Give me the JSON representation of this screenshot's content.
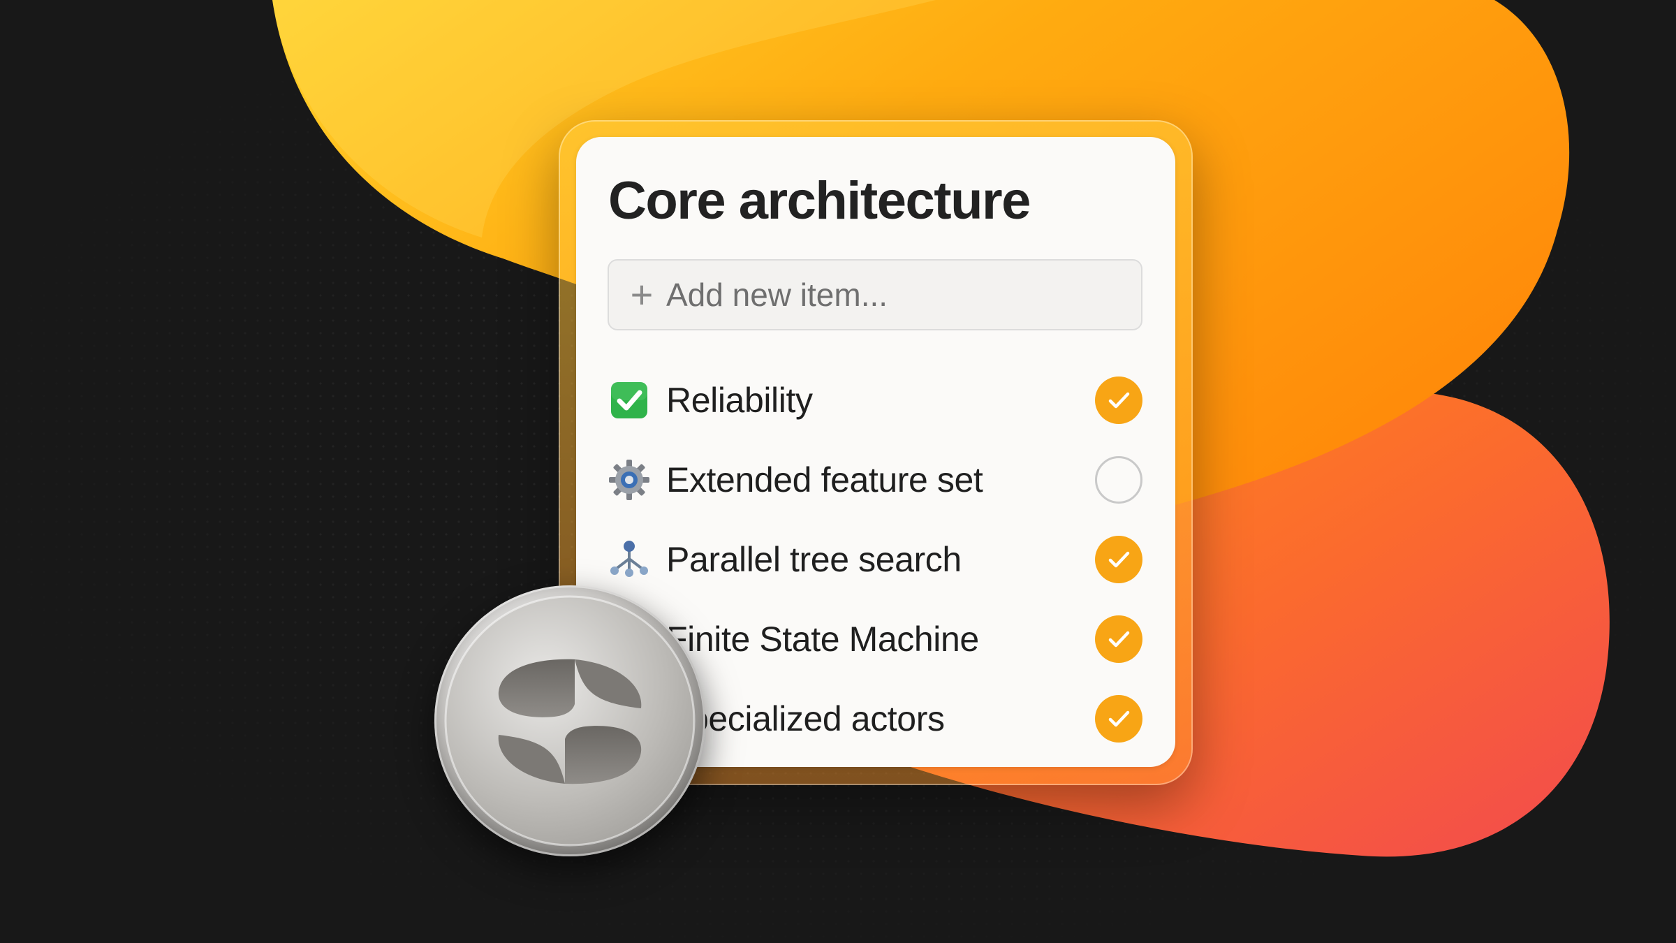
{
  "card": {
    "title": "Core architecture",
    "add_placeholder": "Add new item..."
  },
  "items": [
    {
      "icon": "check-box-icon",
      "label": "Reliability",
      "done": true
    },
    {
      "icon": "gear-icon",
      "label": "Extended feature set",
      "done": false
    },
    {
      "icon": "tree-icon",
      "label": "Parallel tree search",
      "done": true
    },
    {
      "icon": "state-machine-icon",
      "label": "Finite State Machine",
      "done": true
    },
    {
      "icon": "actors-icon",
      "label": "Specialized actors",
      "done": true
    }
  ],
  "colors": {
    "background": "#181818",
    "blob_yellow": "#ffc828",
    "blob_orange": "#ff9a0a",
    "blob_red": "#f55245",
    "check_on": "#f8a515",
    "emoji_green": "#2fb34a"
  },
  "logo": {
    "icon": "metal-coin-logo-icon"
  }
}
